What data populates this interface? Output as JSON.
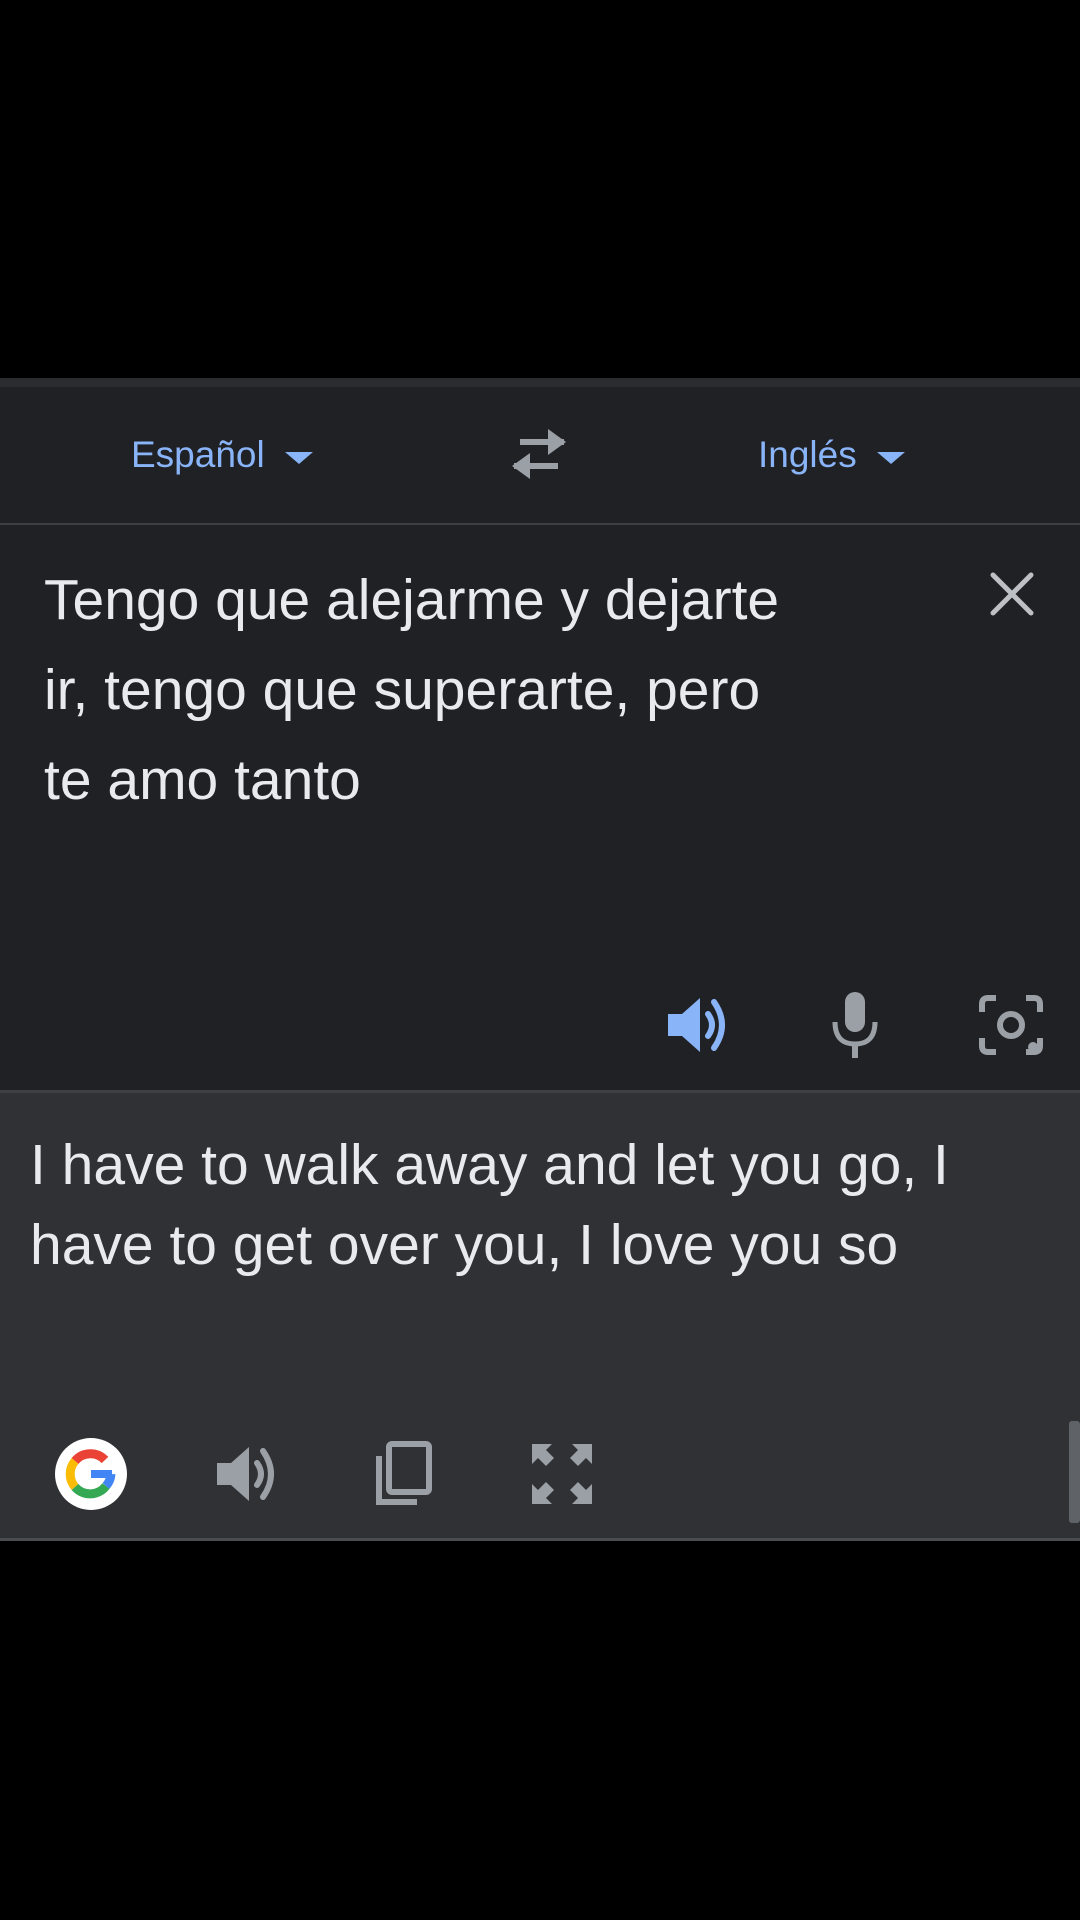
{
  "language_bar": {
    "source_language": "Español",
    "target_language": "Inglés",
    "swap_icon": "swap-arrows-icon",
    "dropdown_icon": "caret-down-icon"
  },
  "source": {
    "text": "Tengo que alejarme y dejarte ir, tengo que superarte, pero te amo tanto",
    "clear_icon": "close-icon",
    "actions": [
      "speaker-icon",
      "microphone-icon",
      "camera-icon"
    ]
  },
  "translation": {
    "text": "I have to walk away and let you go, I have to get over you, I love you so",
    "actions": [
      "google-logo-icon",
      "speaker-icon",
      "copy-icon",
      "fullscreen-icon"
    ]
  },
  "colors": {
    "background": "#000000",
    "panel": "#202124",
    "translation_panel": "#303134",
    "accent": "#8ab4f8",
    "text": "#e8eaed",
    "icon_muted": "#9aa0a6"
  }
}
